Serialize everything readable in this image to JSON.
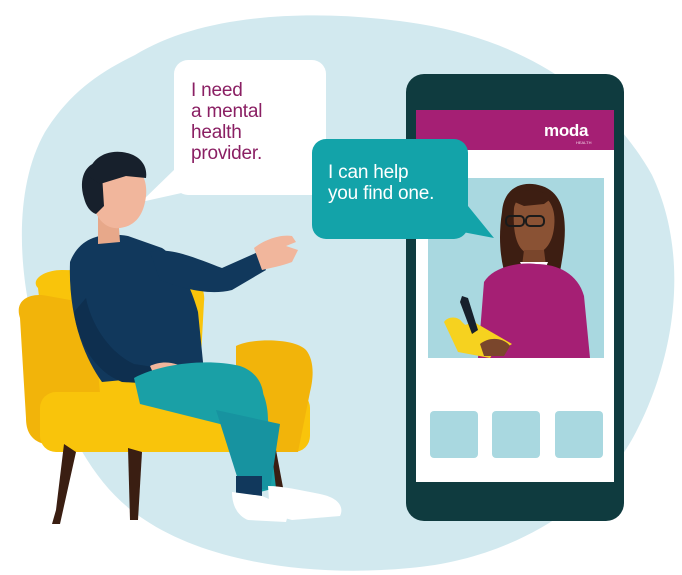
{
  "colors": {
    "backdrop_blob": "#d2e9ef",
    "brand_magenta": "#a51f74",
    "phone_frame": "#0f3b3f",
    "phone_screen": "#ffffff",
    "video_panel": "#a9d8e0",
    "speech_bubble_white": "#ffffff",
    "speech_bubble_teal": "#13a3a9",
    "armchair_yellow": "#f9c40b",
    "man_sweater": "#11385c",
    "man_pants": "#1aa0a6",
    "woman_sweater": "#a51f74",
    "clipboard": "#f6d21f"
  },
  "icons": {
    "user": "man-seated-in-armchair",
    "provider": "woman-provider-with-clipboard",
    "tiles": "placeholder-tile"
  },
  "user_bubble": {
    "lines": [
      "I need",
      "a mental",
      "health",
      "provider."
    ]
  },
  "provider_bubble": {
    "lines": [
      "I can help",
      "you find one."
    ]
  },
  "phone": {
    "logo": "moda",
    "logo_sub": "HEALTH",
    "tiles": [
      "",
      "",
      ""
    ]
  }
}
